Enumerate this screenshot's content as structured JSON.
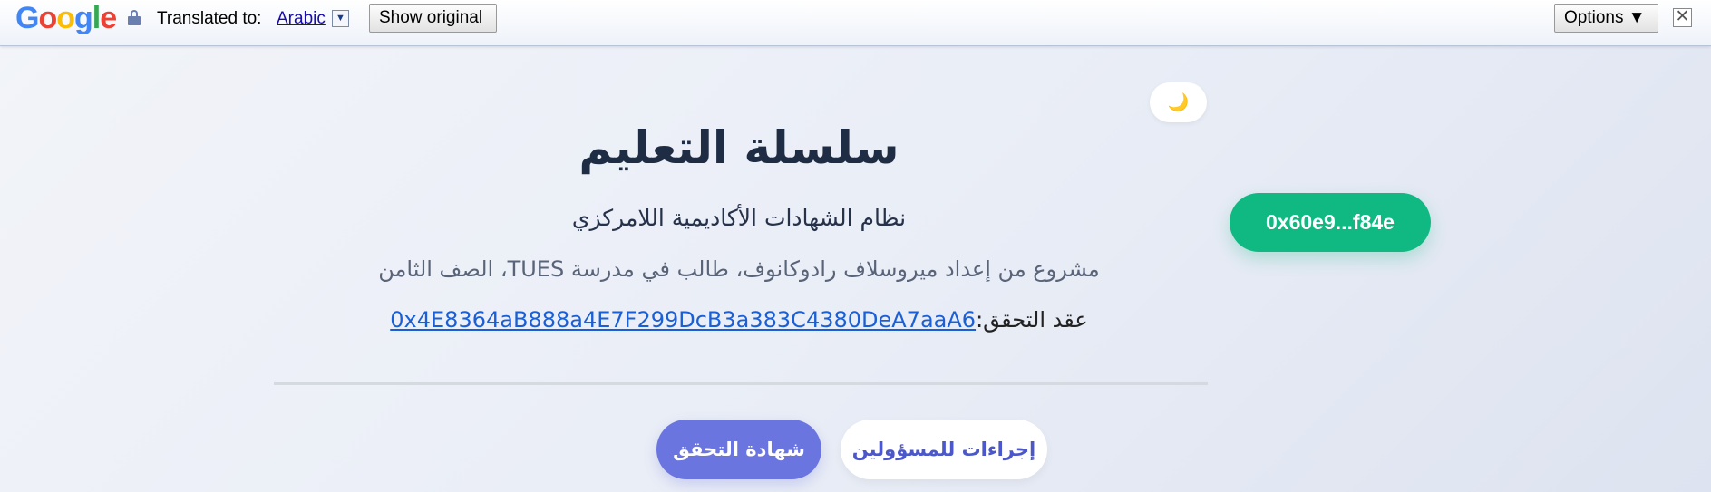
{
  "translate_bar": {
    "logo": {
      "g1": "G",
      "o1": "o",
      "o2": "o",
      "g2": "g",
      "l": "l",
      "e": "e"
    },
    "translated_to_label": "Translated to:",
    "language": "Arabic",
    "language_dropdown_glyph": "▼",
    "show_original_label": "Show original",
    "options_label": "Options ▼",
    "close_glyph": "✕"
  },
  "page": {
    "theme_toggle_icon": "🌙",
    "wallet_address": "0x60e9...f84e",
    "title": "سلسلة التعليم",
    "subtitle": "نظام الشهادات الأكاديمية اللامركزي",
    "author": "مشروع من إعداد ميروسلاف رادوكانوف، طالب في مدرسة TUES، الصف الثامن",
    "contract_label": "عقد التحقق:",
    "contract_address": "0x4E8364aB888a4E7F299DcB3a383C4380DeA7aaA6",
    "verify_button": "شهادة التحقق",
    "admin_button": "إجراءات للمسؤولين"
  },
  "colors": {
    "wallet_green": "#10b981",
    "primary_purple": "#6a75e0",
    "link_blue": "#1a5fd6",
    "title_dark": "#1f2d44"
  }
}
